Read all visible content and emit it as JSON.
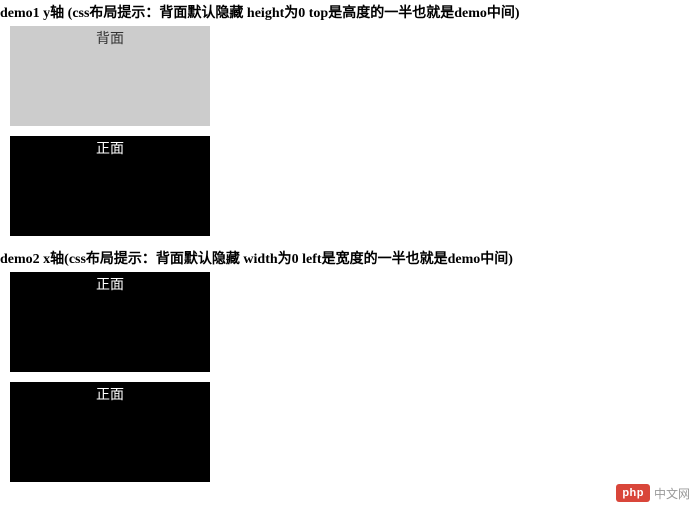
{
  "section1": {
    "heading": "demo1 y轴 (css布局提示：背面默认隐藏 height为0 top是高度的一半也就是demo中间)",
    "back_label": "背面",
    "front_label": "正面"
  },
  "section2": {
    "heading": "demo2 x轴(css布局提示：背面默认隐藏 width为0 left是宽度的一半也就是demo中间)",
    "front_label_a": "正面",
    "front_label_b": "正面"
  },
  "watermark": {
    "badge": "php",
    "cn": "中文网"
  }
}
